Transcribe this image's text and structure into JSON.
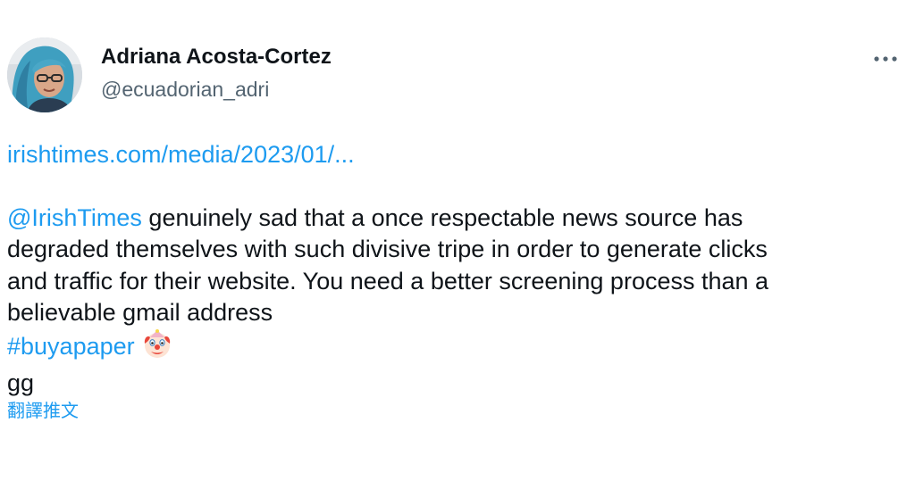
{
  "author": {
    "display_name": "Adriana Acosta-Cortez",
    "handle": "@ecuadorian_adri",
    "avatar_icon": "profile-photo"
  },
  "menu": {
    "icon": "more-horizontal-icon"
  },
  "link": {
    "text": "irishtimes.com/media/2023/01/..."
  },
  "body": {
    "mention": "@IrishTimes",
    "line1_rest": " genuinely sad that a once respectable news source has",
    "line2": "degraded themselves with such divisive tripe in order to generate clicks",
    "line3": "and traffic for their website. You need a better screening process than a",
    "line4": "believable gmail address",
    "hashtag": "#buyapaper",
    "emoji_icon": "clown-face-emoji",
    "line6": "gg"
  },
  "translate_label": "翻譯推文",
  "colors": {
    "link": "#1d9bf0",
    "text": "#0f1419",
    "secondary": "#536471"
  }
}
